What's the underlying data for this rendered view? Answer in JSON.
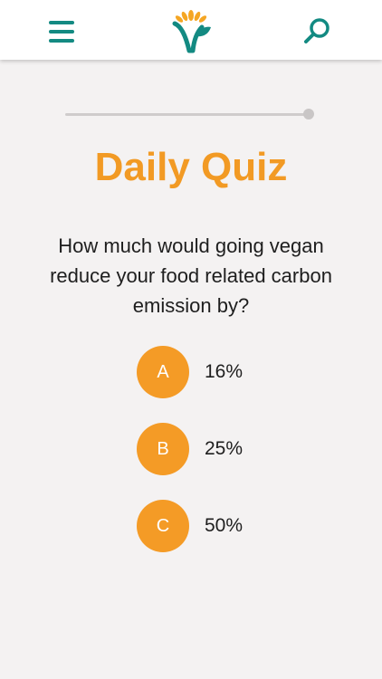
{
  "header": {
    "menu_icon": "hamburger-menu-icon",
    "logo_icon": "vegan-v-flower-logo",
    "search_icon": "magnifier-search-icon"
  },
  "quiz": {
    "progress": 1.0,
    "title": "Daily Quiz",
    "question": "How much would going vegan reduce your food related carbon emission by?",
    "options": [
      {
        "letter": "A",
        "text": "16%"
      },
      {
        "letter": "B",
        "text": "25%"
      },
      {
        "letter": "C",
        "text": "50%"
      }
    ]
  },
  "colors": {
    "accent_orange": "#f29a24",
    "brand_teal": "#138a82",
    "background": "#f4f2f2"
  }
}
